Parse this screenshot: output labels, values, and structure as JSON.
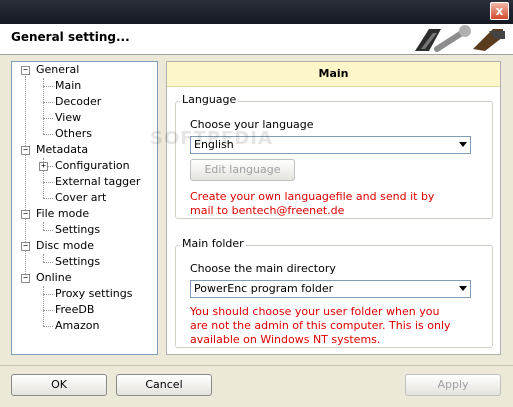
{
  "window": {
    "header_title": "General setting...",
    "close_glyph": "x"
  },
  "tree": {
    "items": [
      {
        "label": "General",
        "level": 0,
        "expander": "−"
      },
      {
        "label": "Main",
        "level": 1
      },
      {
        "label": "Decoder",
        "level": 1
      },
      {
        "label": "View",
        "level": 1
      },
      {
        "label": "Others",
        "level": 1
      },
      {
        "label": "Metadata",
        "level": 0,
        "expander": "−"
      },
      {
        "label": "Configuration",
        "level": 1,
        "expander": "+"
      },
      {
        "label": "External tagger",
        "level": 1
      },
      {
        "label": "Cover art",
        "level": 1
      },
      {
        "label": "File mode",
        "level": 0,
        "expander": "−"
      },
      {
        "label": "Settings",
        "level": 1
      },
      {
        "label": "Disc mode",
        "level": 0,
        "expander": "−"
      },
      {
        "label": "Settings",
        "level": 1
      },
      {
        "label": "Online",
        "level": 0,
        "expander": "−"
      },
      {
        "label": "Proxy settings",
        "level": 1
      },
      {
        "label": "FreeDB",
        "level": 1
      },
      {
        "label": "Amazon",
        "level": 1
      }
    ]
  },
  "panel": {
    "title": "Main",
    "language_group": {
      "title": "Language",
      "prompt": "Choose your language",
      "selected": "English",
      "edit_button": "Edit language",
      "hint_line1": "Create your own languagefile and send it by",
      "hint_line2": "mail to bentech@freenet.de"
    },
    "folder_group": {
      "title": "Main folder",
      "prompt": "Choose the main directory",
      "selected": "PowerEnc program folder",
      "hint_line1": "You should choose your user folder when you",
      "hint_line2": "are not the admin of this computer. This is only",
      "hint_line3": "available on Windows NT systems."
    }
  },
  "buttons": {
    "ok": "OK",
    "cancel": "Cancel",
    "apply": "Apply"
  },
  "watermark": "SOFTPEDIA"
}
